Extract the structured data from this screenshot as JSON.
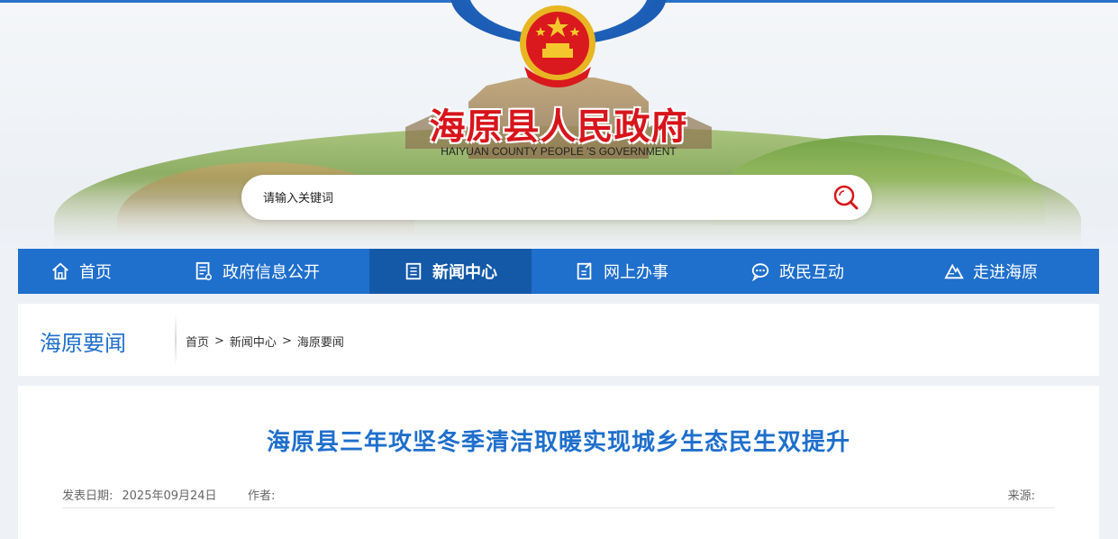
{
  "header": {
    "title": "海原县人民政府",
    "subtitle": "HAIYUAN COUNTY PEOPLE 'S GOVERNMENT",
    "emblem": "national-emblem"
  },
  "search": {
    "placeholder": "请输入关键词",
    "icon": "search-icon"
  },
  "nav": {
    "items": [
      {
        "label": "首页",
        "icon": "home-icon",
        "active": false
      },
      {
        "label": "政府信息公开",
        "icon": "document-icon",
        "active": false
      },
      {
        "label": "新闻中心",
        "icon": "news-icon",
        "active": true
      },
      {
        "label": "网上办事",
        "icon": "edit-icon",
        "active": false
      },
      {
        "label": "政民互动",
        "icon": "chat-icon",
        "active": false
      },
      {
        "label": "走进海原",
        "icon": "mountain-icon",
        "active": false
      }
    ]
  },
  "section": {
    "title": "海原要闻",
    "breadcrumb": [
      "首页",
      "新闻中心",
      "海原要闻"
    ],
    "separator": ">"
  },
  "article": {
    "title": "海原县三年攻坚冬季清洁取暖实现城乡生态民生双提升",
    "date_label": "发表日期:",
    "date": "2025年09月24日",
    "author_label": "作者:",
    "author": "",
    "source_label": "来源:",
    "source": ""
  },
  "colors": {
    "primary": "#1f6fcc",
    "nav_active": "#1459a8",
    "title_red": "#d7151b"
  }
}
